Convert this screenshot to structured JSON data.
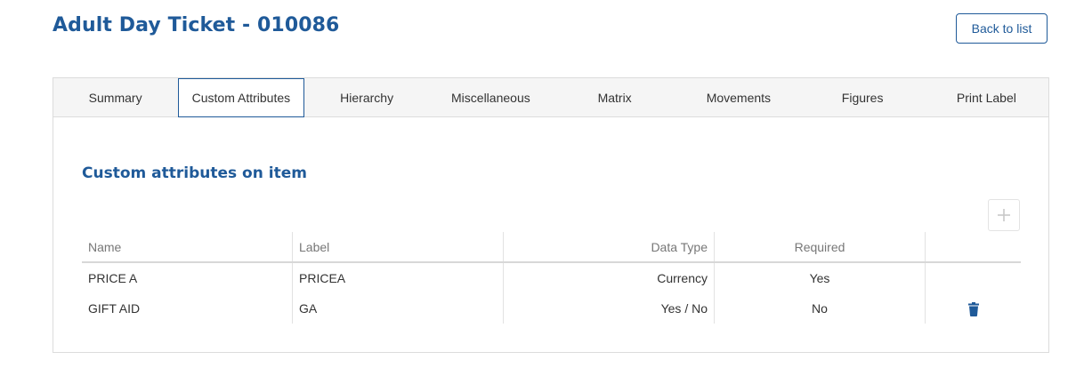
{
  "header": {
    "title": "Adult Day Ticket - 010086",
    "back_label": "Back to list"
  },
  "tabs": [
    {
      "label": "Summary",
      "active": false
    },
    {
      "label": "Custom Attributes",
      "active": true
    },
    {
      "label": "Hierarchy",
      "active": false
    },
    {
      "label": "Miscellaneous",
      "active": false
    },
    {
      "label": "Matrix",
      "active": false
    },
    {
      "label": "Movements",
      "active": false
    },
    {
      "label": "Figures",
      "active": false
    },
    {
      "label": "Print Label",
      "active": false
    }
  ],
  "section": {
    "title": "Custom attributes on item",
    "add_icon": "plus-icon"
  },
  "table": {
    "columns": [
      "Name",
      "Label",
      "Data Type",
      "Required",
      ""
    ],
    "rows": [
      {
        "name": "PRICE A",
        "label": "PRICEA",
        "data_type": "Currency",
        "required": "Yes",
        "deletable": false
      },
      {
        "name": "GIFT AID",
        "label": "GA",
        "data_type": "Yes / No",
        "required": "No",
        "deletable": true
      }
    ]
  },
  "colors": {
    "accent": "#1f5a99",
    "border": "#dcdcdc",
    "tab_bg": "#f5f5f5"
  }
}
